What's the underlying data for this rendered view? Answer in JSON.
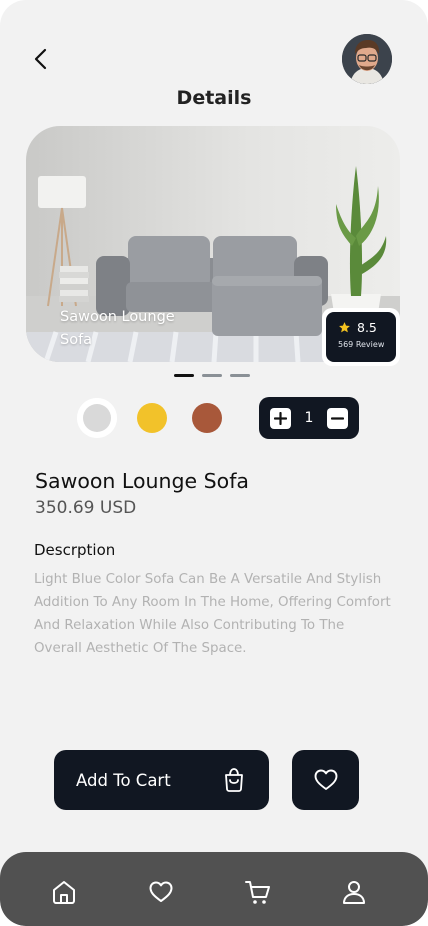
{
  "header": {
    "title": "Details",
    "back_icon": "chevron-left-icon",
    "avatar_icon": "user-avatar"
  },
  "hero": {
    "name": "Sawoon Lounge Sofa",
    "rating": "8.5",
    "reviews": "569 Review",
    "carousel_active_index": 0,
    "carousel_count": 3
  },
  "colors": {
    "options": [
      {
        "name": "grey",
        "hex": "#d9d9d9",
        "selected": true
      },
      {
        "name": "yellow",
        "hex": "#f2c22a",
        "selected": false
      },
      {
        "name": "brown",
        "hex": "#a8583a",
        "selected": false
      }
    ]
  },
  "quantity": {
    "value": "1",
    "increment_icon": "plus-icon",
    "decrement_icon": "minus-icon"
  },
  "product": {
    "name": "Sawoon Lounge Sofa",
    "price": "350.69 USD"
  },
  "description": {
    "title": "Descrption",
    "text": "Light Blue Color Sofa Can Be A Versatile And Stylish Addition To Any Room In The Home, Offering Comfort And Relaxation While Also Contributing To The Overall Aesthetic Of The Space."
  },
  "actions": {
    "add_to_cart_label": "Add To Cart",
    "cart_icon": "shopping-bag-icon",
    "favorite_icon": "heart-icon"
  },
  "bottom_nav": {
    "items": [
      "home-icon",
      "heart-icon",
      "cart-icon",
      "profile-icon"
    ]
  },
  "theme": {
    "dark": "#111722",
    "background": "#f2f2f2",
    "nav_background": "#515151"
  }
}
